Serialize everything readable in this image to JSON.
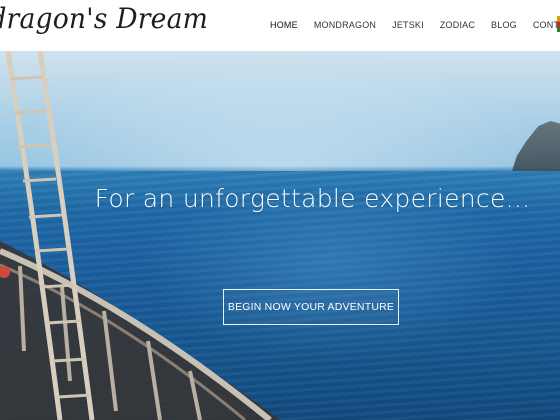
{
  "site": {
    "logo_text": "ndragon's Dream"
  },
  "nav": {
    "items": [
      {
        "label": "HOME",
        "active": true
      },
      {
        "label": "MONDRAGON",
        "active": false
      },
      {
        "label": "JETSKI",
        "active": false
      },
      {
        "label": "ZODIAC",
        "active": false
      },
      {
        "label": "BLOG",
        "active": false
      },
      {
        "label": "CONTACT",
        "active": false
      }
    ]
  },
  "hero": {
    "headline": "For an unforgettable experience...",
    "cta_label": "BEGIN NOW YOUR ADVENTURE"
  },
  "colors": {
    "header_bg": "#ffffff",
    "sea": "#1a5f9e",
    "sky": "#b9d8ea",
    "cta_border": "#ffffff"
  }
}
